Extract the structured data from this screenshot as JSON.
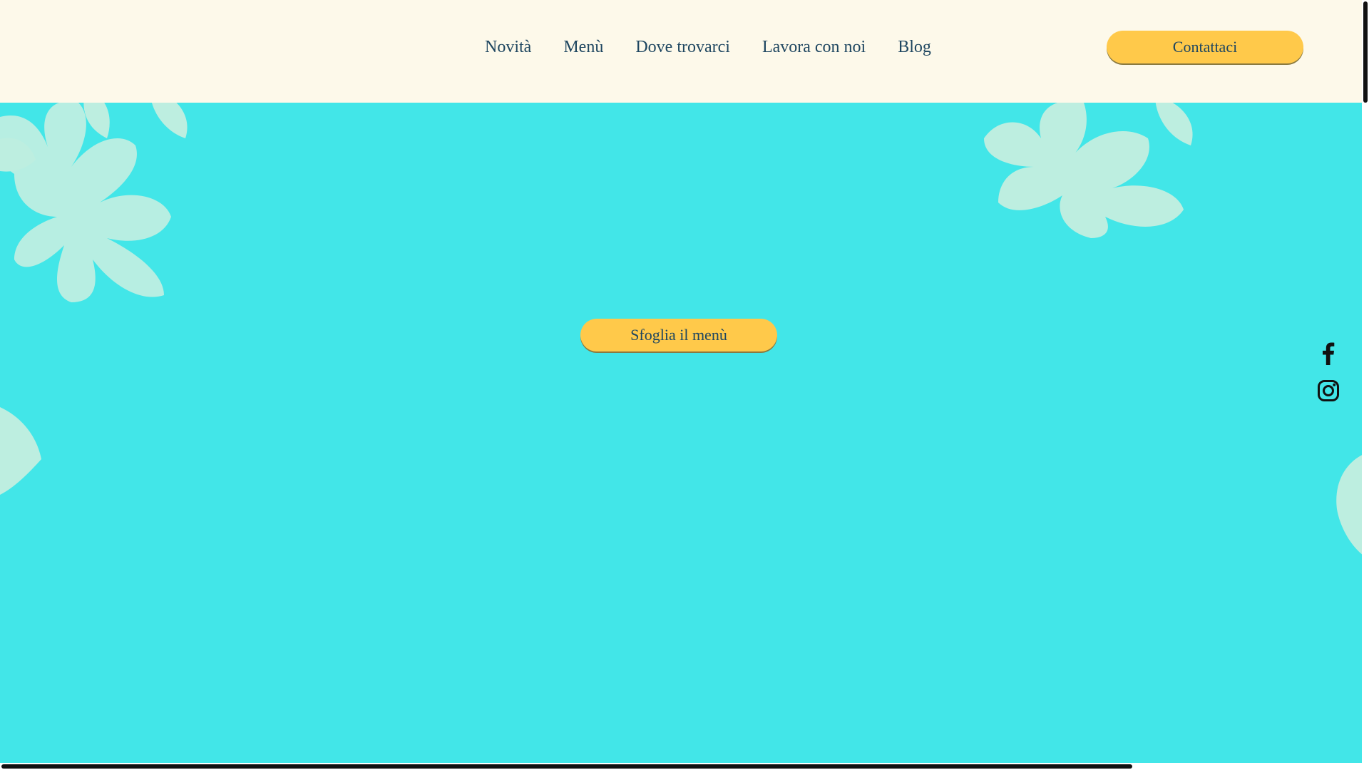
{
  "header": {
    "nav": [
      {
        "label": "Novità"
      },
      {
        "label": "Menù"
      },
      {
        "label": "Dove trovarci"
      },
      {
        "label": "Lavora con noi"
      },
      {
        "label": "Blog"
      }
    ],
    "contact_label": "Contattaci"
  },
  "hero": {
    "menu_button_label": "Sfoglia il menù",
    "background_color": "#42e6e8",
    "leaf_color": "#c8efe0"
  },
  "social": {
    "icons": [
      "facebook-icon",
      "instagram-icon"
    ]
  },
  "colors": {
    "header_bg": "#fdf9ea",
    "button_bg": "#ffc94a",
    "text": "#1e4660"
  }
}
